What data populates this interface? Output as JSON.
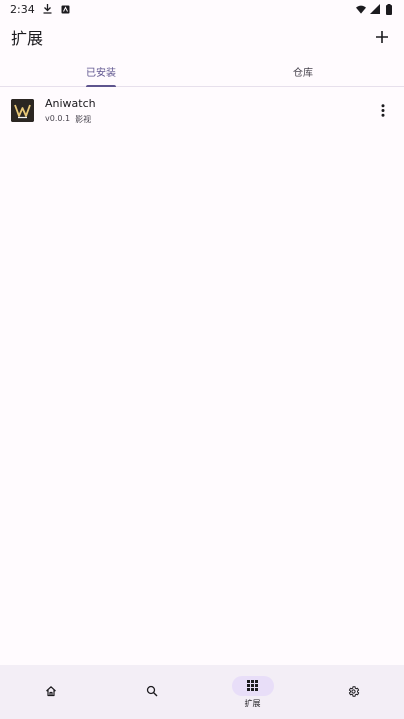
{
  "status_bar": {
    "time": "2:34"
  },
  "app_bar": {
    "title": "扩展"
  },
  "tabs": [
    {
      "label": "已安装",
      "active": true
    },
    {
      "label": "仓库",
      "active": false
    }
  ],
  "extensions": [
    {
      "name": "Aniwatch",
      "version": "v0.0.1",
      "category": "影视"
    }
  ],
  "bottom_nav": {
    "items": [
      {
        "icon": "home-icon",
        "label": "",
        "active": false
      },
      {
        "icon": "search-icon",
        "label": "",
        "active": false
      },
      {
        "icon": "grid-icon",
        "label": "扩展",
        "active": true
      },
      {
        "icon": "gear-icon",
        "label": "",
        "active": false
      }
    ]
  },
  "colors": {
    "background": "#fffbfe",
    "accent": "#5e548e",
    "nav_background": "#f3eef6",
    "active_pill": "#e8def8"
  }
}
